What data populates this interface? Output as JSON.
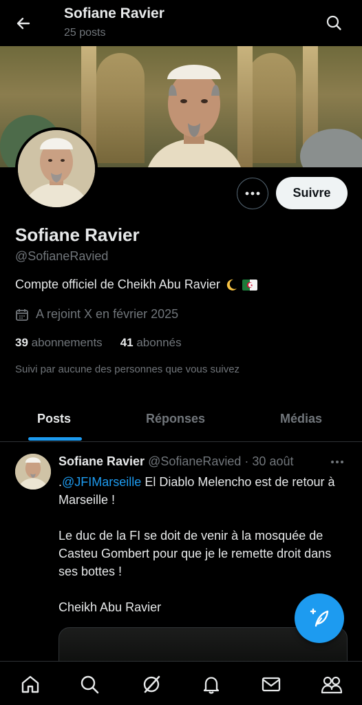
{
  "header": {
    "title": "Sofiane Ravier",
    "post_count": "25 posts"
  },
  "profile": {
    "name": "Sofiane Ravier",
    "handle": "@SofianeRavied",
    "bio": "Compte officiel de Cheikh Abu Ravier",
    "bio_emojis": [
      "crescent-moon",
      "flag-algeria"
    ],
    "joined": "A rejoint X en février 2025",
    "following_count": "39",
    "following_label": "abonnements",
    "followers_count": "41",
    "followers_label": "abonnés",
    "followed_by": "Suivi par aucune des personnes que vous suivez",
    "follow_button": "Suivre"
  },
  "tabs": [
    {
      "label": "Posts",
      "active": true
    },
    {
      "label": "Réponses",
      "active": false
    },
    {
      "label": "Médias",
      "active": false
    }
  ],
  "post": {
    "author": "Sofiane Ravier",
    "meta": "@SofianeRavied · 30 août",
    "mention": "@JFIMarseille",
    "body_lead": ".",
    "body_after_mention": " El Diablo Melencho est de retour à Marseille !",
    "body_rest": "Le duc de la FI se doit de venir à la mosquée de Casteu Gombert pour que je le remette droit dans ses bottes !",
    "signature": "Cheikh Abu Ravier"
  },
  "colors": {
    "accent": "#1d9bf0",
    "background": "#000000",
    "text": "#e7e9ea",
    "muted": "#71767b"
  },
  "bottom_nav": [
    "home-icon",
    "search-icon",
    "grok-icon",
    "notifications-icon",
    "messages-icon",
    "communities-icon"
  ]
}
